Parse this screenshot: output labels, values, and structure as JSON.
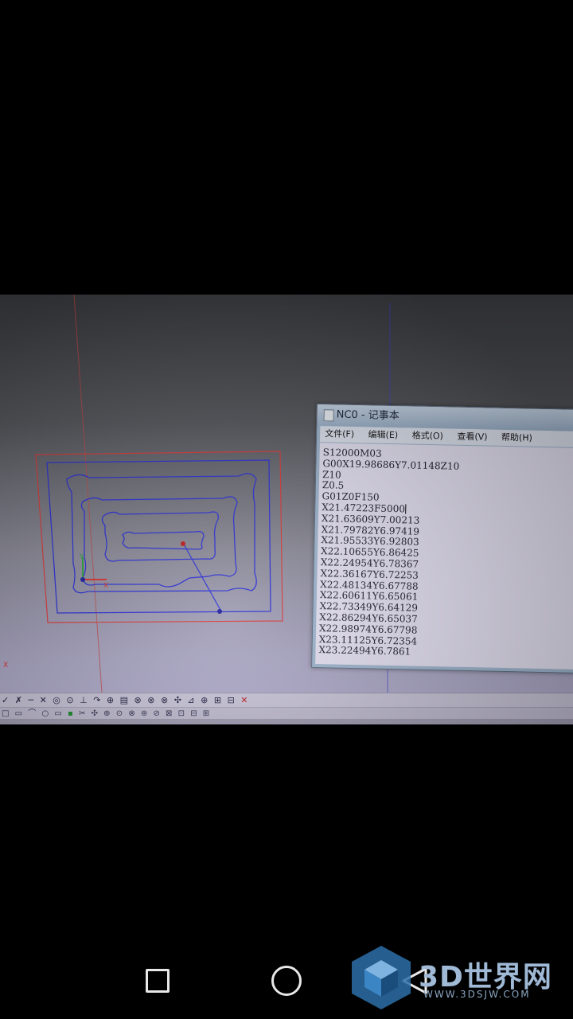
{
  "notepad": {
    "title": "NC0 - 记事本",
    "menu": [
      "文件(F)",
      "编辑(E)",
      "格式(O)",
      "查看(V)",
      "帮助(H)"
    ],
    "lines": [
      "S12000M03",
      "G00X19.98686Y7.01148Z10",
      "Z10",
      "Z0.5",
      "G01Z0F150",
      "X21.47223F5000",
      "X21.63609Y7.00213",
      "X21.79782Y6.97419",
      "X21.95533Y6.92803",
      "X22.10655Y6.86425",
      "X22.24954Y6.78367",
      "X22.36167Y6.72253",
      "X22.48134Y6.67788",
      "X22.60611Y6.65061",
      "X22.73349Y6.64129",
      "X22.86294Y6.65037",
      "X22.98974Y6.67798",
      "X23.11125Y6.72354",
      "X23.22494Y6.7861"
    ]
  },
  "cad": {
    "axis_x_label": "X",
    "axis_y_label": "Y",
    "corner_label": "X",
    "toolpath_color": "#2a2fd6",
    "boundary_color": "#d83a3a",
    "toolbar1_icons": [
      "✓",
      "✗",
      "─",
      "✕",
      "◎",
      "⊙",
      "⊥",
      "↷",
      "⊕",
      "▤",
      "⊗",
      "⊗",
      "⊗",
      "✣",
      "⊿",
      "⊕",
      "⊞",
      "⊟",
      "✕"
    ],
    "toolbar2_icons": [
      "□",
      "▭",
      "⌒",
      "○",
      "▭",
      "▪",
      "✂",
      "✣",
      "⊕",
      "⊙",
      "⊗",
      "⊛",
      "⊘",
      "⊠",
      "⊡",
      "⊟",
      "⊞"
    ]
  },
  "watermark": {
    "text": "3D世界网",
    "sub": "WWW.3DSJW.COM"
  }
}
